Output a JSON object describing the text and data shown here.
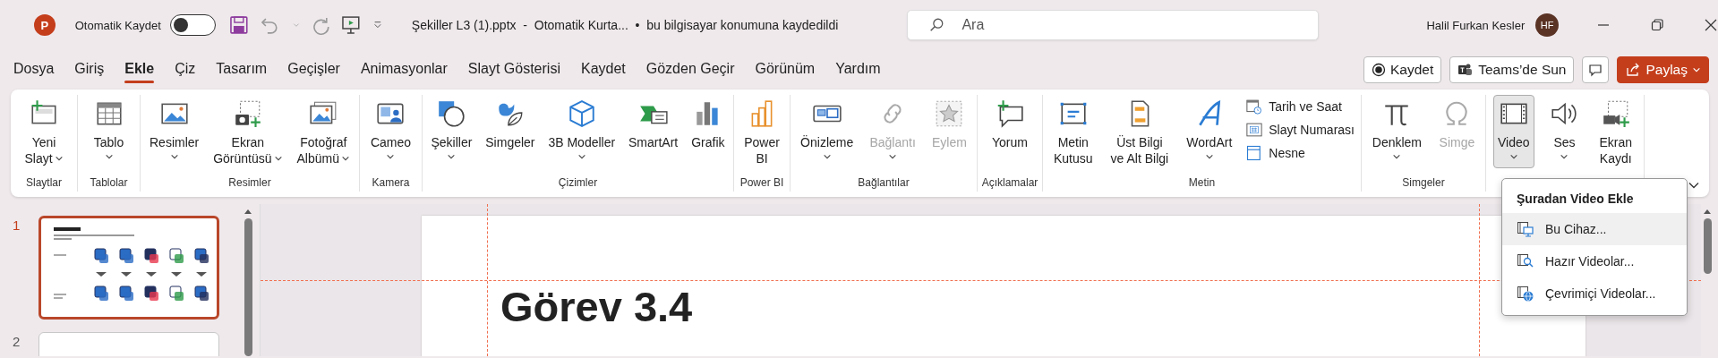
{
  "app": {
    "logo_letter": "P"
  },
  "title_bar": {
    "autosave": {
      "label": "Otomatik Kaydet",
      "on": false
    },
    "document_title": "Şekiller L3 (1).pptx  -  Otomatik Kurta...  •  bu bilgisayar konumuna kaydedildi",
    "search": {
      "placeholder": "Ara"
    },
    "user": {
      "name": "Halil Furkan Kesler",
      "initials": "HF"
    }
  },
  "tabs": [
    {
      "label": "Dosya",
      "selected": false
    },
    {
      "label": "Giriş",
      "selected": false
    },
    {
      "label": "Ekle",
      "selected": true
    },
    {
      "label": "Çiz",
      "selected": false
    },
    {
      "label": "Tasarım",
      "selected": false
    },
    {
      "label": "Geçişler",
      "selected": false
    },
    {
      "label": "Animasyonlar",
      "selected": false
    },
    {
      "label": "Slayt Gösterisi",
      "selected": false
    },
    {
      "label": "Kaydet",
      "selected": false
    },
    {
      "label": "Gözden Geçir",
      "selected": false
    },
    {
      "label": "Görünüm",
      "selected": false
    },
    {
      "label": "Yardım",
      "selected": false
    }
  ],
  "tab_actions": [
    {
      "kind": "record",
      "label": "Kaydet"
    },
    {
      "kind": "teams",
      "label": "Teams’de Sun"
    },
    {
      "kind": "comments"
    },
    {
      "kind": "share",
      "label": "Paylaş"
    }
  ],
  "ribbon": {
    "groups": [
      {
        "label": "Slaytlar",
        "items": [
          {
            "kind": "large",
            "label": "Yeni\nSlayt",
            "dropdown": true,
            "caret_inline": true,
            "disabled": false,
            "pressed": false
          }
        ]
      },
      {
        "label": "Tablolar",
        "items": [
          {
            "kind": "large",
            "label": "Tablo",
            "dropdown": true,
            "caret_inline": false,
            "disabled": false,
            "pressed": false
          }
        ]
      },
      {
        "label": "Resimler",
        "items": [
          {
            "kind": "large",
            "label": "Resimler",
            "dropdown": true,
            "caret_inline": false,
            "disabled": false,
            "pressed": false
          },
          {
            "kind": "large",
            "label": "Ekran\nGörüntüsü",
            "dropdown": true,
            "caret_inline": true,
            "disabled": false,
            "pressed": false
          },
          {
            "kind": "large",
            "label": "Fotoğraf\nAlbümü",
            "dropdown": true,
            "caret_inline": true,
            "disabled": false,
            "pressed": false
          }
        ]
      },
      {
        "label": "Kamera",
        "items": [
          {
            "kind": "large",
            "label": "Cameo",
            "dropdown": true,
            "caret_inline": false,
            "disabled": false,
            "pressed": false
          }
        ]
      },
      {
        "label": "Çizimler",
        "items": [
          {
            "kind": "large",
            "label": "Şekiller",
            "dropdown": true,
            "caret_inline": false,
            "disabled": false,
            "pressed": false
          },
          {
            "kind": "large",
            "label": "Simgeler",
            "dropdown": false,
            "disabled": false,
            "pressed": false
          },
          {
            "kind": "large",
            "label": "3B Modeller",
            "dropdown": true,
            "caret_inline": false,
            "disabled": false,
            "pressed": false
          },
          {
            "kind": "large",
            "label": "SmartArt",
            "dropdown": false,
            "disabled": false,
            "pressed": false
          },
          {
            "kind": "large",
            "label": "Grafik",
            "dropdown": false,
            "disabled": false,
            "pressed": false
          }
        ]
      },
      {
        "label": "Power BI",
        "items": [
          {
            "kind": "large",
            "label": "Power\nBI",
            "dropdown": false,
            "disabled": false,
            "pressed": false
          }
        ]
      },
      {
        "label": "Bağlantılar",
        "items": [
          {
            "kind": "large",
            "label": "Önizleme",
            "dropdown": true,
            "caret_inline": false,
            "disabled": false,
            "pressed": false
          },
          {
            "kind": "large",
            "label": "Bağlantı",
            "dropdown": true,
            "caret_inline": false,
            "disabled": true,
            "pressed": false
          },
          {
            "kind": "large",
            "label": "Eylem",
            "dropdown": false,
            "disabled": true,
            "pressed": false
          }
        ]
      },
      {
        "label": "Açıklamalar",
        "items": [
          {
            "kind": "large",
            "label": "Yorum",
            "dropdown": false,
            "disabled": false,
            "pressed": false
          }
        ]
      },
      {
        "label": "Metin",
        "items": [
          {
            "kind": "large",
            "label": "Metin\nKutusu",
            "dropdown": false,
            "disabled": false,
            "pressed": false
          },
          {
            "kind": "large",
            "label": "Üst Bilgi\nve Alt Bilgi",
            "dropdown": false,
            "disabled": false,
            "pressed": false
          },
          {
            "kind": "large",
            "label": "WordArt",
            "dropdown": true,
            "caret_inline": false,
            "disabled": false,
            "pressed": false
          },
          {
            "kind": "stack",
            "items": [
              {
                "label": "Tarih ve Saat",
                "disabled": false
              },
              {
                "label": "Slayt Numarası",
                "disabled": false
              },
              {
                "label": "Nesne",
                "disabled": false
              }
            ]
          }
        ]
      },
      {
        "label": "Simgeler",
        "items": [
          {
            "kind": "large",
            "label": "Denklem",
            "dropdown": true,
            "caret_inline": false,
            "disabled": false,
            "pressed": false
          },
          {
            "kind": "large",
            "label": "Simge",
            "dropdown": false,
            "disabled": true,
            "pressed": false
          }
        ]
      },
      {
        "items": [
          {
            "kind": "large",
            "label": "Video",
            "dropdown": true,
            "caret_inline": false,
            "disabled": false,
            "pressed": true
          },
          {
            "kind": "large",
            "label": "Ses",
            "dropdown": true,
            "caret_inline": false,
            "disabled": false,
            "pressed": false
          },
          {
            "kind": "large",
            "label": "Ekran\nKaydı",
            "dropdown": false,
            "disabled": false,
            "pressed": false
          }
        ]
      }
    ]
  },
  "video_menu": {
    "title": "Şuradan Video Ekle",
    "items": [
      {
        "label": "Bu Cihaz...",
        "selected": true
      },
      {
        "label": "Hazır Videolar...",
        "selected": false
      },
      {
        "label": "Çevrimiçi Videolar...",
        "selected": false
      }
    ]
  },
  "slides_pane": {
    "slides": [
      {
        "number": "1",
        "selected": true
      },
      {
        "number": "2",
        "selected": false
      }
    ]
  },
  "slide": {
    "title": "Görev 3.4"
  }
}
